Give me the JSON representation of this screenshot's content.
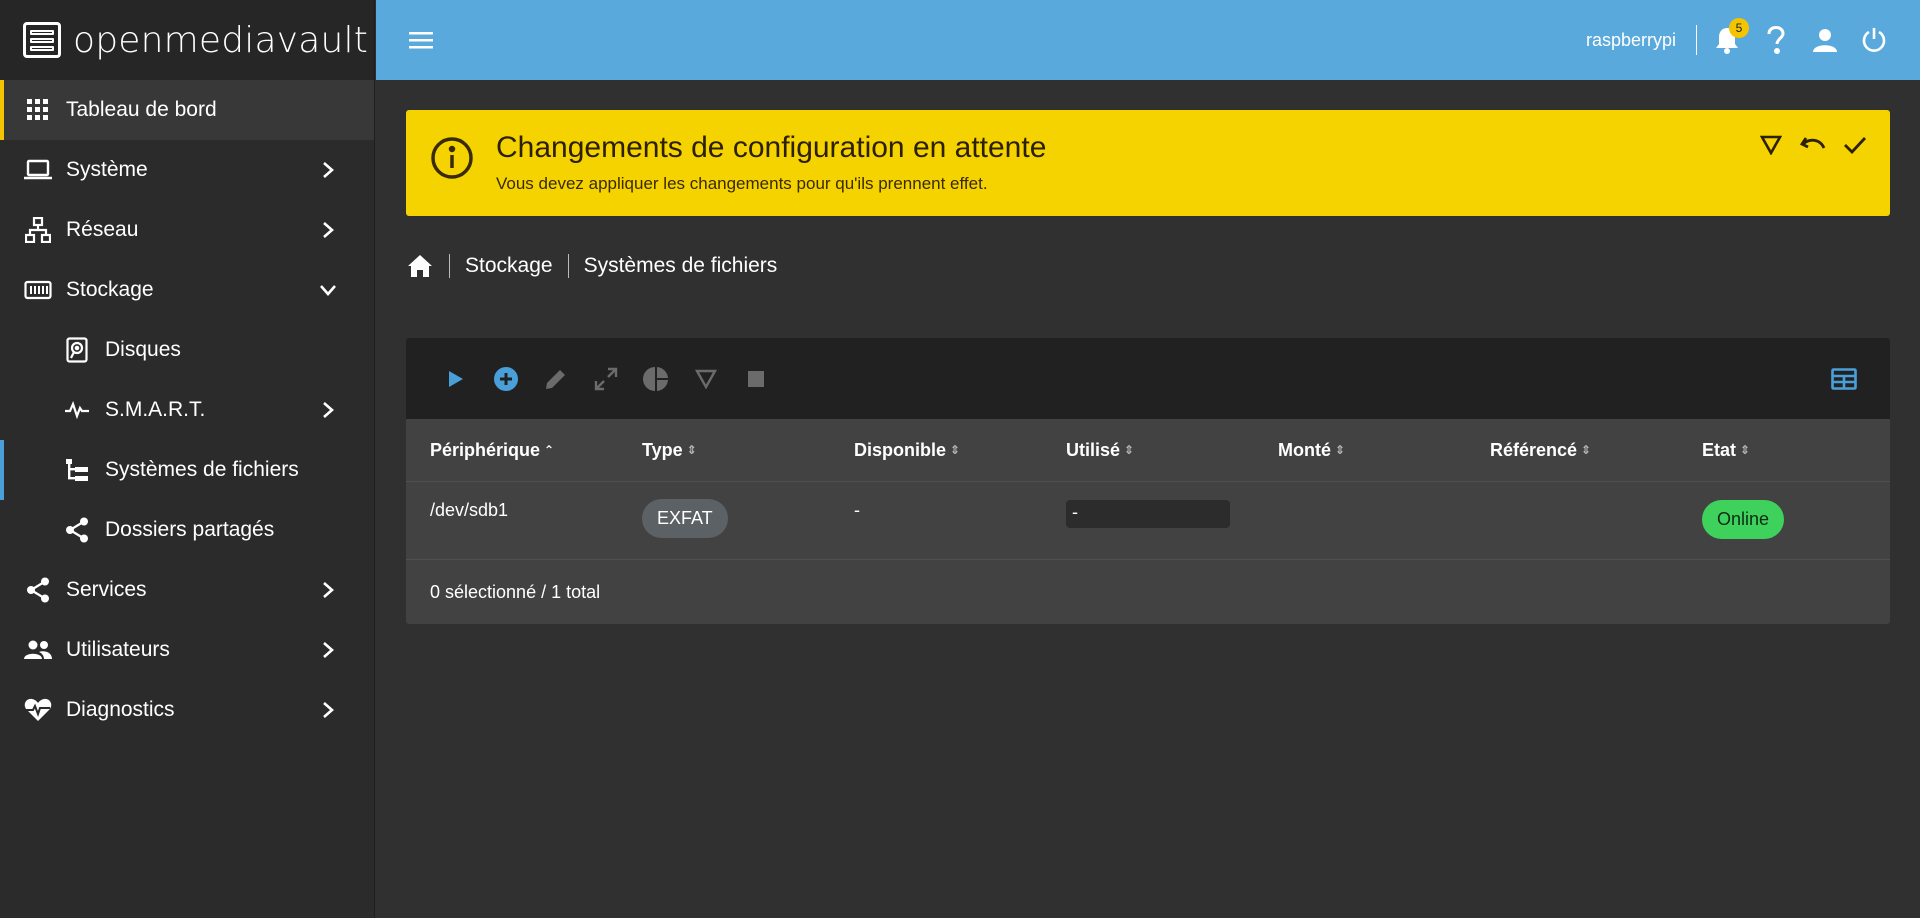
{
  "app": {
    "brand": "openmediavault"
  },
  "topbar": {
    "hostname": "raspberrypi",
    "notifications_count": "5",
    "icons": [
      "menu-icon",
      "bell-icon",
      "help-icon",
      "user-icon",
      "power-icon"
    ]
  },
  "sidebar": {
    "items": [
      {
        "label": "Tableau de bord",
        "icon": "grid-icon",
        "active": true
      },
      {
        "label": "Système",
        "icon": "laptop-icon"
      },
      {
        "label": "Réseau",
        "icon": "network-icon"
      },
      {
        "label": "Stockage",
        "icon": "storage-icon",
        "expanded": true
      },
      {
        "label": "Disques",
        "icon": "disk-icon"
      },
      {
        "label": "S.M.A.R.T.",
        "icon": "pulse-icon"
      },
      {
        "label": "Systèmes de fichiers",
        "icon": "tree-icon",
        "current": true
      },
      {
        "label": "Dossiers partagés",
        "icon": "share-icon"
      },
      {
        "label": "Services",
        "icon": "share-icon"
      },
      {
        "label": "Utilisateurs",
        "icon": "users-icon"
      },
      {
        "label": "Diagnostics",
        "icon": "heart-pulse-icon"
      }
    ]
  },
  "alert": {
    "title": "Changements de configuration en attente",
    "text": "Vous devez appliquer les changements pour qu'ils prennent effet.",
    "accent": "#f5d300"
  },
  "breadcrumb": {
    "items": [
      "Stockage",
      "Systèmes de fichiers"
    ]
  },
  "table": {
    "columns": [
      "Périphérique",
      "Type",
      "Disponible",
      "Utilisé",
      "Monté",
      "Référencé",
      "Etat"
    ],
    "rows": [
      {
        "device": "/dev/sdb1",
        "type": "EXFAT",
        "available": "-",
        "used": "-",
        "mounted": "",
        "referenced": "",
        "status": "Online"
      }
    ],
    "footer": "0 sélectionné / 1 total"
  },
  "colors": {
    "topbar": "#5aa9dd",
    "active_marker": "#f5c400",
    "current_marker": "#4a9fd8",
    "status_online": "#3ed15c"
  }
}
